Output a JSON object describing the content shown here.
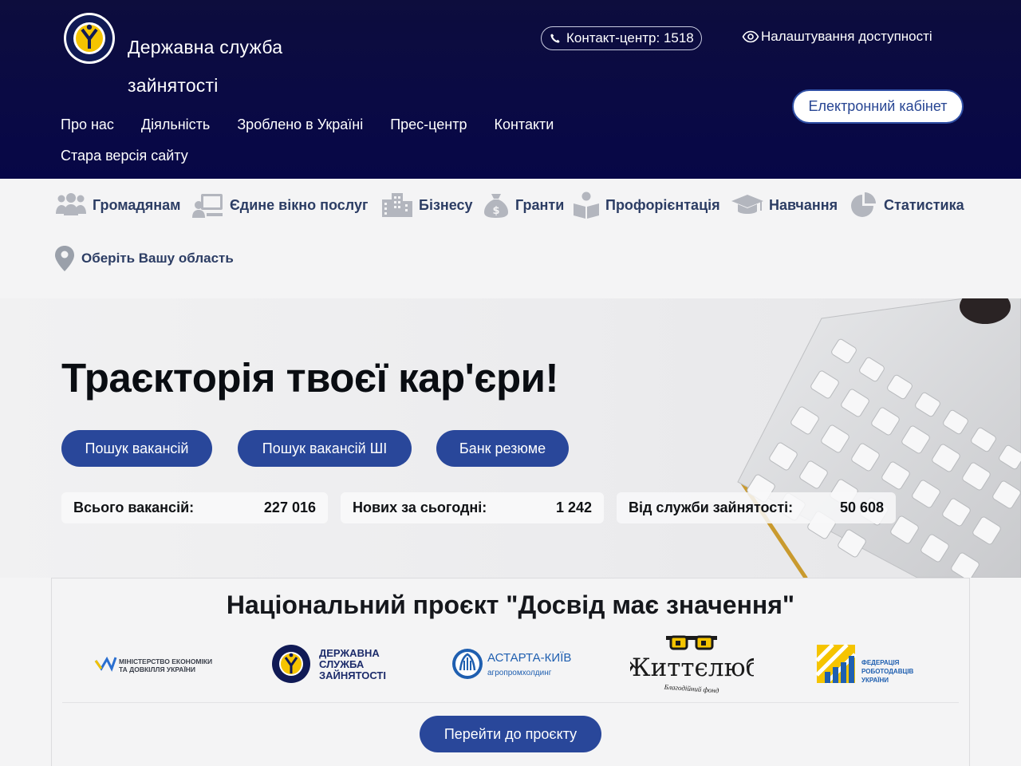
{
  "header": {
    "brand_line1": "Державна служба",
    "brand_line2": "зайнятості",
    "contact": "Контакт-центр: 1518",
    "accessibility": "Налаштування доступності",
    "cabinet": "Електронний кабінет",
    "logo_text": "ДЕРЖАВНА СЛУЖБА ЗАЙНЯТОСТІ"
  },
  "nav": {
    "items": [
      {
        "label": "Про нас"
      },
      {
        "label": "Діяльність"
      },
      {
        "label": "Зроблено в Україні"
      },
      {
        "label": "Прес-центр"
      },
      {
        "label": "Контакти"
      }
    ],
    "old_site": "Стара версія сайту"
  },
  "categories": [
    {
      "label": "Громадянам",
      "icon": "people-icon"
    },
    {
      "label": "Єдине вікно послуг",
      "icon": "service-window-icon"
    },
    {
      "label": "Бізнесу",
      "icon": "buildings-icon"
    },
    {
      "label": "Гранти",
      "icon": "money-bag-icon"
    },
    {
      "label": "Профорієнтація",
      "icon": "career-guidance-icon"
    },
    {
      "label": "Навчання",
      "icon": "graduation-cap-icon"
    },
    {
      "label": "Статистика",
      "icon": "pie-chart-icon"
    }
  ],
  "region": {
    "label": "Оберіть Вашу область",
    "icon": "map-pin-icon"
  },
  "hero": {
    "title": "Траєкторія твоєї кар'єри!",
    "buttons": [
      "Пошук вакансій",
      "Пошук вакансій ШІ",
      "Банк резюме"
    ],
    "stats": [
      {
        "label": "Всього вакансій:",
        "value": "227 016"
      },
      {
        "label": "Нових за сьогодні:",
        "value": "1 242"
      },
      {
        "label": "Від служби зайнятості:",
        "value": "50 608"
      }
    ]
  },
  "project": {
    "title": "Національний проєкт \"Досвід має значення\"",
    "button": "Перейти до проєкту",
    "partners": {
      "ministry_line1": "МІНІСТЕРСТВО ЕКОНОМІКИ",
      "ministry_line2": "ТА ДОВКІЛЛЯ УКРАЇНИ",
      "dsz_line1": "ДЕРЖАВНА",
      "dsz_line2": "СЛУЖБА",
      "dsz_line3": "ЗАЙНЯТОСТІ",
      "astarta_line1": "АСТАРТА-КИЇВ",
      "astarta_line2": "агропромхолдинг",
      "zhyttelub_line1": "Життєлюб",
      "zhyttelub_line2": "Благодійний фонд",
      "federation_line1": "ФЕДЕРАЦІЯ",
      "federation_line2": "РОБОТОДАВЦІВ",
      "federation_line3": "УКРАЇНИ"
    }
  },
  "colors": {
    "header_bg": "#0a0a44",
    "accent": "#29479a",
    "category_text": "#2c3d64"
  }
}
